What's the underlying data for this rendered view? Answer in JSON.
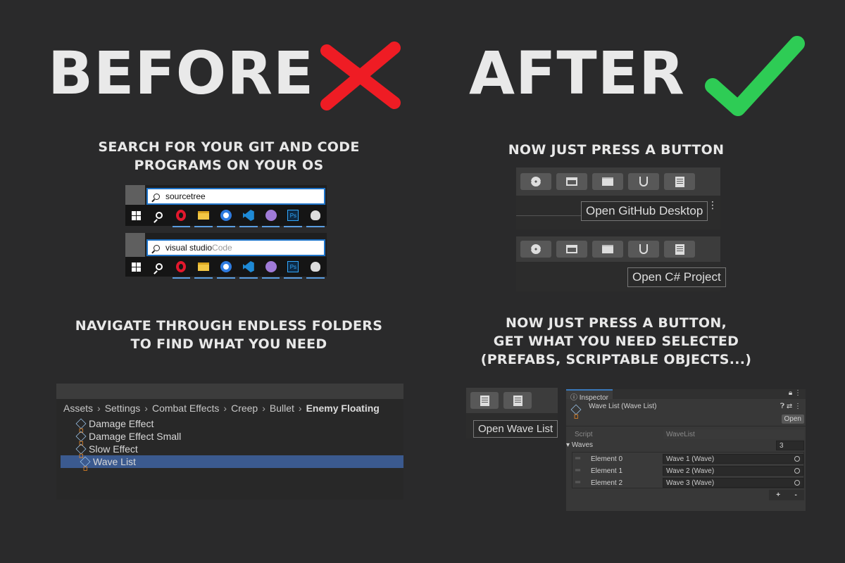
{
  "headings": {
    "before": "BEFORE",
    "after": "AFTER",
    "before_mark_color": "#ef1c24",
    "after_mark_color": "#2ecc55"
  },
  "captions": {
    "search_line1": "SEARCH FOR YOUR GIT AND CODE",
    "search_line2": "PROGRAMS ON YOUR OS",
    "press_button": "NOW JUST PRESS A BUTTON",
    "navigate_line1": "NAVIGATE THROUGH ENDLESS FOLDERS",
    "navigate_line2": "TO FIND WHAT YOU NEED",
    "press_select_line1": "NOW JUST PRESS A BUTTON,",
    "press_select_line2": "GET WHAT YOU NEED SELECTED",
    "press_select_line3": "(PREFABS, SCRIPTABLE OBJECTS...)"
  },
  "windows_search": [
    {
      "typed": "sourcetree",
      "completion": ""
    },
    {
      "typed": "visual studio",
      "completion": " Code"
    }
  ],
  "taskbar_icons": [
    "windows-start-icon",
    "search-icon",
    "opera-icon",
    "file-explorer-icon",
    "app-icon",
    "vscode-icon",
    "github-icon",
    "photoshop-icon",
    "unreal-icon"
  ],
  "taskbar_ps_label": "Ps",
  "unity_toolbar": {
    "icons": [
      "gear-icon",
      "archive-icon",
      "folder-icon",
      "branch-icon",
      "document-icon"
    ],
    "tooltip_github": "Open GitHub Desktop",
    "tooltip_csharp": "Open C# Project",
    "tooltip_wave_list": "Open Wave List"
  },
  "project": {
    "breadcrumb": [
      "Assets",
      "Settings",
      "Combat Effects",
      "Creep",
      "Bullet",
      "Enemy Floating"
    ],
    "assets": [
      "Damage Effect",
      "Damage Effect Small",
      "Slow Effect",
      "Wave List"
    ],
    "selected": "Wave List"
  },
  "inspector": {
    "tab": "Inspector",
    "title": "Wave List (Wave List)",
    "open_button": "Open",
    "script_label": "Script",
    "script_value": "WaveList",
    "array_label": "Waves",
    "array_size": "3",
    "elements": [
      {
        "label": "Element 0",
        "value": "Wave 1 (Wave)"
      },
      {
        "label": "Element 1",
        "value": "Wave 2 (Wave)"
      },
      {
        "label": "Element 2",
        "value": "Wave 3 (Wave)"
      }
    ],
    "add_label": "+",
    "remove_label": "-"
  }
}
